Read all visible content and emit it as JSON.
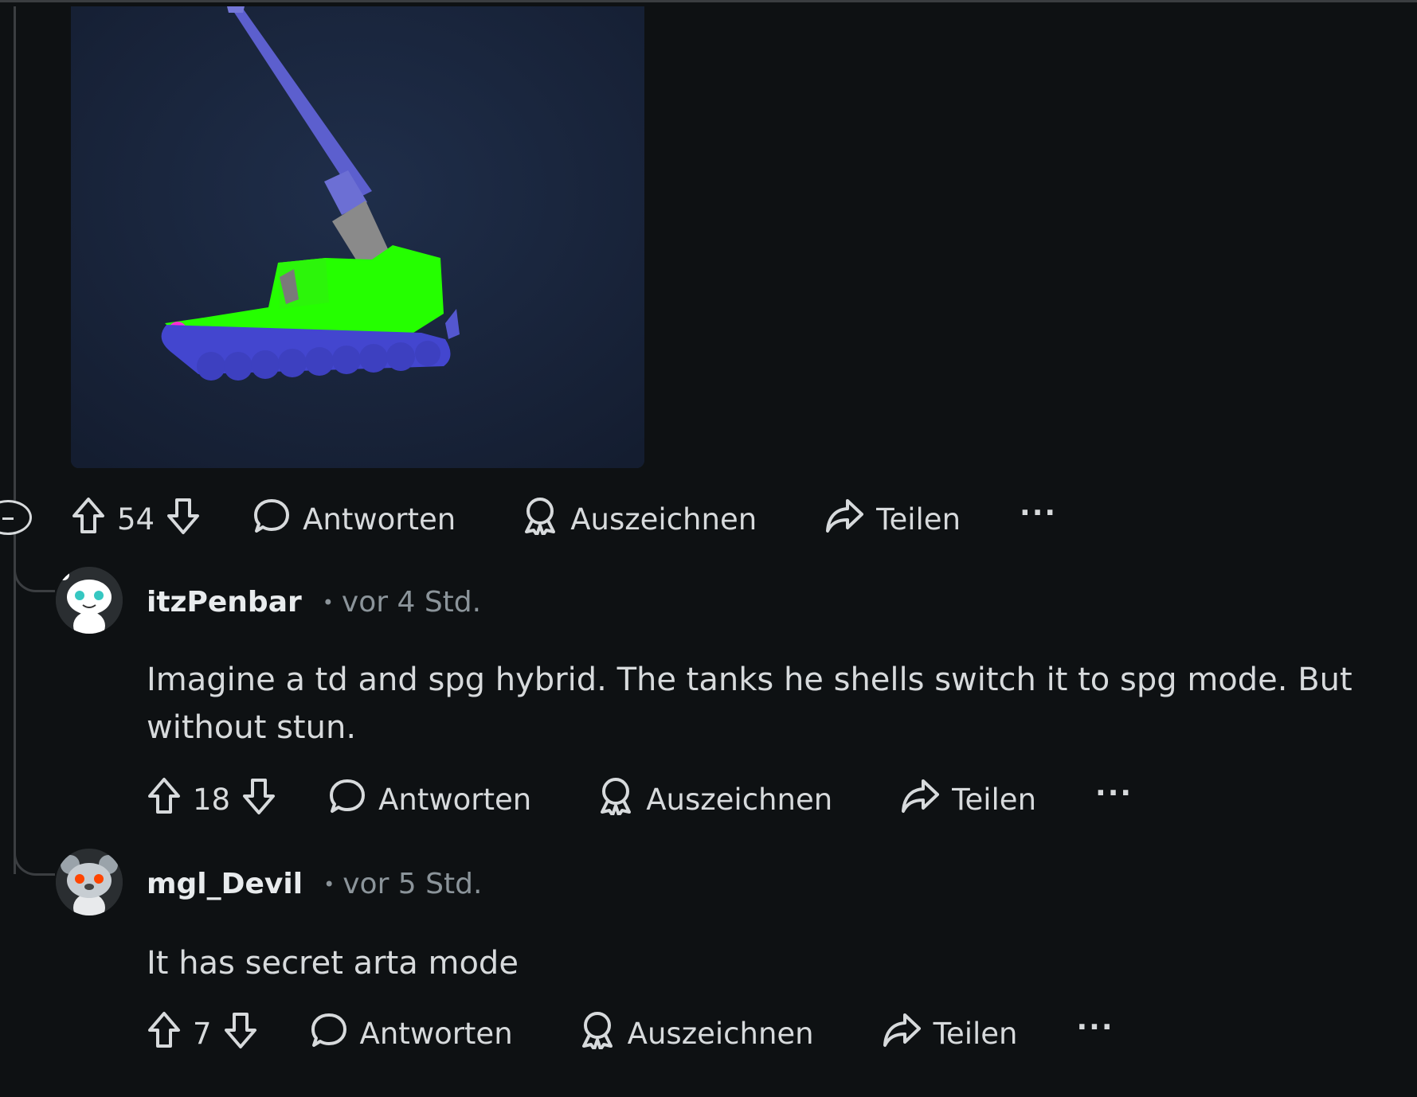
{
  "post": {
    "media_alt": "",
    "actions": {
      "votes": "54",
      "reply_label": "Antworten",
      "award_label": "Auszeichnen",
      "share_label": "Teilen",
      "more_label": "···"
    }
  },
  "comments": [
    {
      "username": "itzPenbar",
      "time": "vor 4 Std.",
      "text": "Imagine a td and spg hybrid. The tanks he shells switch it to spg mode. But without stun.",
      "votes": "18",
      "reply_label": "Antworten",
      "award_label": "Auszeichnen",
      "share_label": "Teilen",
      "more_label": "···"
    },
    {
      "username": "mgl_Devil",
      "time": "vor 5 Std.",
      "text": "It has secret arta mode",
      "votes": "7",
      "reply_label": "Antworten",
      "award_label": "Auszeichnen",
      "share_label": "Teilen",
      "more_label": "···"
    }
  ],
  "icons": {
    "upvote": "upvote-arrow-icon",
    "downvote": "downvote-arrow-icon",
    "reply": "speech-bubble-icon",
    "award": "award-ribbon-icon",
    "share": "share-arrow-icon",
    "collapse": "collapse-minus-icon"
  },
  "colors": {
    "background": "#0e1113",
    "text": "#d7dadc",
    "muted": "#8b949a",
    "tank_green": "#22ff00",
    "tank_blue": "#4b4fd6"
  }
}
